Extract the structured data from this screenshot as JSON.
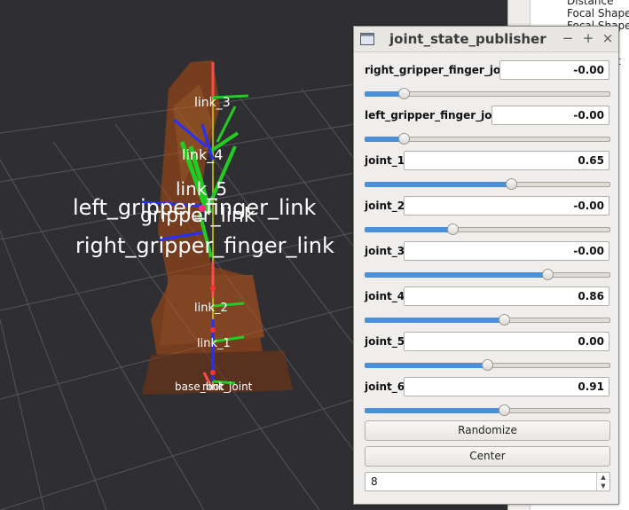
{
  "rviz_panel": {
    "properties": [
      "Distance",
      "Focal Shape",
      "Focal Shape"
    ],
    "extra": "t"
  },
  "scene": {
    "frame_labels": {
      "link3": "link_3",
      "link4": "link_4",
      "link5": "link_5",
      "gripper": "gripper_link",
      "left_finger": "left_gripper_finger_link",
      "right_finger": "right_gripper_finger_link",
      "link2": "link_2",
      "link1": "link_1",
      "base": "base_link",
      "root": "root_joint"
    }
  },
  "jsp": {
    "title": "joint_state_publisher",
    "buttons": {
      "minimize": "−",
      "maximize": "+",
      "close": "×"
    },
    "joints": [
      {
        "name": "right_gripper_finger_joint",
        "value": "-0.00",
        "slider_pct": 16
      },
      {
        "name": "left_gripper_finger_joint",
        "value": "-0.00",
        "slider_pct": 16
      },
      {
        "name": "joint_1",
        "value": "0.65",
        "slider_pct": 60
      },
      {
        "name": "joint_2",
        "value": "-0.00",
        "slider_pct": 36
      },
      {
        "name": "joint_3",
        "value": "-0.00",
        "slider_pct": 75
      },
      {
        "name": "joint_4",
        "value": "0.86",
        "slider_pct": 57
      },
      {
        "name": "joint_5",
        "value": "0.00",
        "slider_pct": 50
      },
      {
        "name": "joint_6",
        "value": "0.91",
        "slider_pct": 57
      }
    ],
    "randomize_label": "Randomize",
    "center_label": "Center",
    "spin_value": "8",
    "accent": "#4a90d9"
  }
}
